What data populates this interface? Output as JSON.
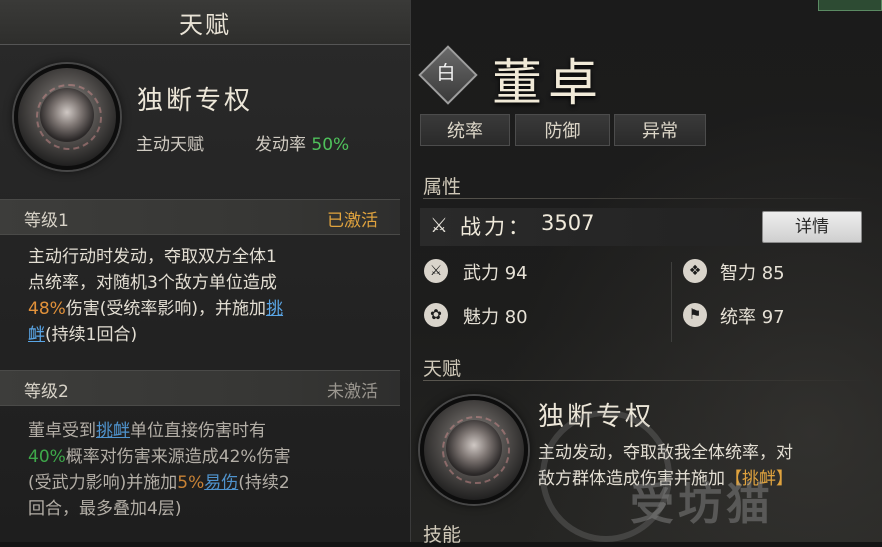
{
  "left_panel": {
    "header_title": "天赋",
    "skill": {
      "name": "独断专权",
      "type": "主动天赋",
      "trigger_label": "发动率",
      "trigger_rate": "50%"
    },
    "levels": [
      {
        "label": "等级1",
        "status": "已激活",
        "desc": {
          "line1": "主动行动时发动，夺取双方全体1",
          "line2": "点统率，对随机3个敌方单位造成",
          "pct": "48%",
          "line3_mid": "伤害(受统率影响)，并施加",
          "link1": "挑",
          "link2": "衅",
          "line4_rest": "(持续1回合)"
        }
      },
      {
        "label": "等级2",
        "status": "未激活",
        "desc": {
          "line1_pre": "董卓受到",
          "link": "挑衅",
          "line1_post": "单位直接伤害时有",
          "pct1": "40%",
          "line2_rest": "概率对伤害来源造成42%伤害",
          "line3_pre": "(受武力影响)并施加",
          "pct2": "5%",
          "link2": "易伤",
          "line3_post": "(持续2",
          "line4": "回合，最多叠加4层)"
        }
      }
    ]
  },
  "hero": {
    "rarity": "白",
    "name": "董卓",
    "traits": [
      "统率",
      "防御",
      "异常"
    ]
  },
  "attributes": {
    "section_title": "属性",
    "power_label": "战力",
    "power_sep": "：",
    "power_value": "3507",
    "detail_button": "详情",
    "stats": [
      {
        "label": "武力",
        "value": "94",
        "icon": "sword-icon"
      },
      {
        "label": "智力",
        "value": "85",
        "icon": "book-icon"
      },
      {
        "label": "魅力",
        "value": "80",
        "icon": "flower-icon"
      },
      {
        "label": "统率",
        "value": "97",
        "icon": "flag-icon"
      }
    ]
  },
  "talent": {
    "section_title": "天赋",
    "name": "独断专权",
    "desc_line1": "主动发动，夺取敌我全体统率，对",
    "desc_line2": "敌方群体造成伤害并施加",
    "tag_open": "【",
    "tag": "挑衅",
    "tag_close": "】"
  },
  "skills": {
    "section_title": "技能"
  },
  "watermark": {
    "text": "受坊猫"
  },
  "colors": {
    "green": "#4fc05b",
    "orange": "#e1913a",
    "link_blue": "#5aa6e6",
    "activated_gold": "#e0a33e"
  }
}
